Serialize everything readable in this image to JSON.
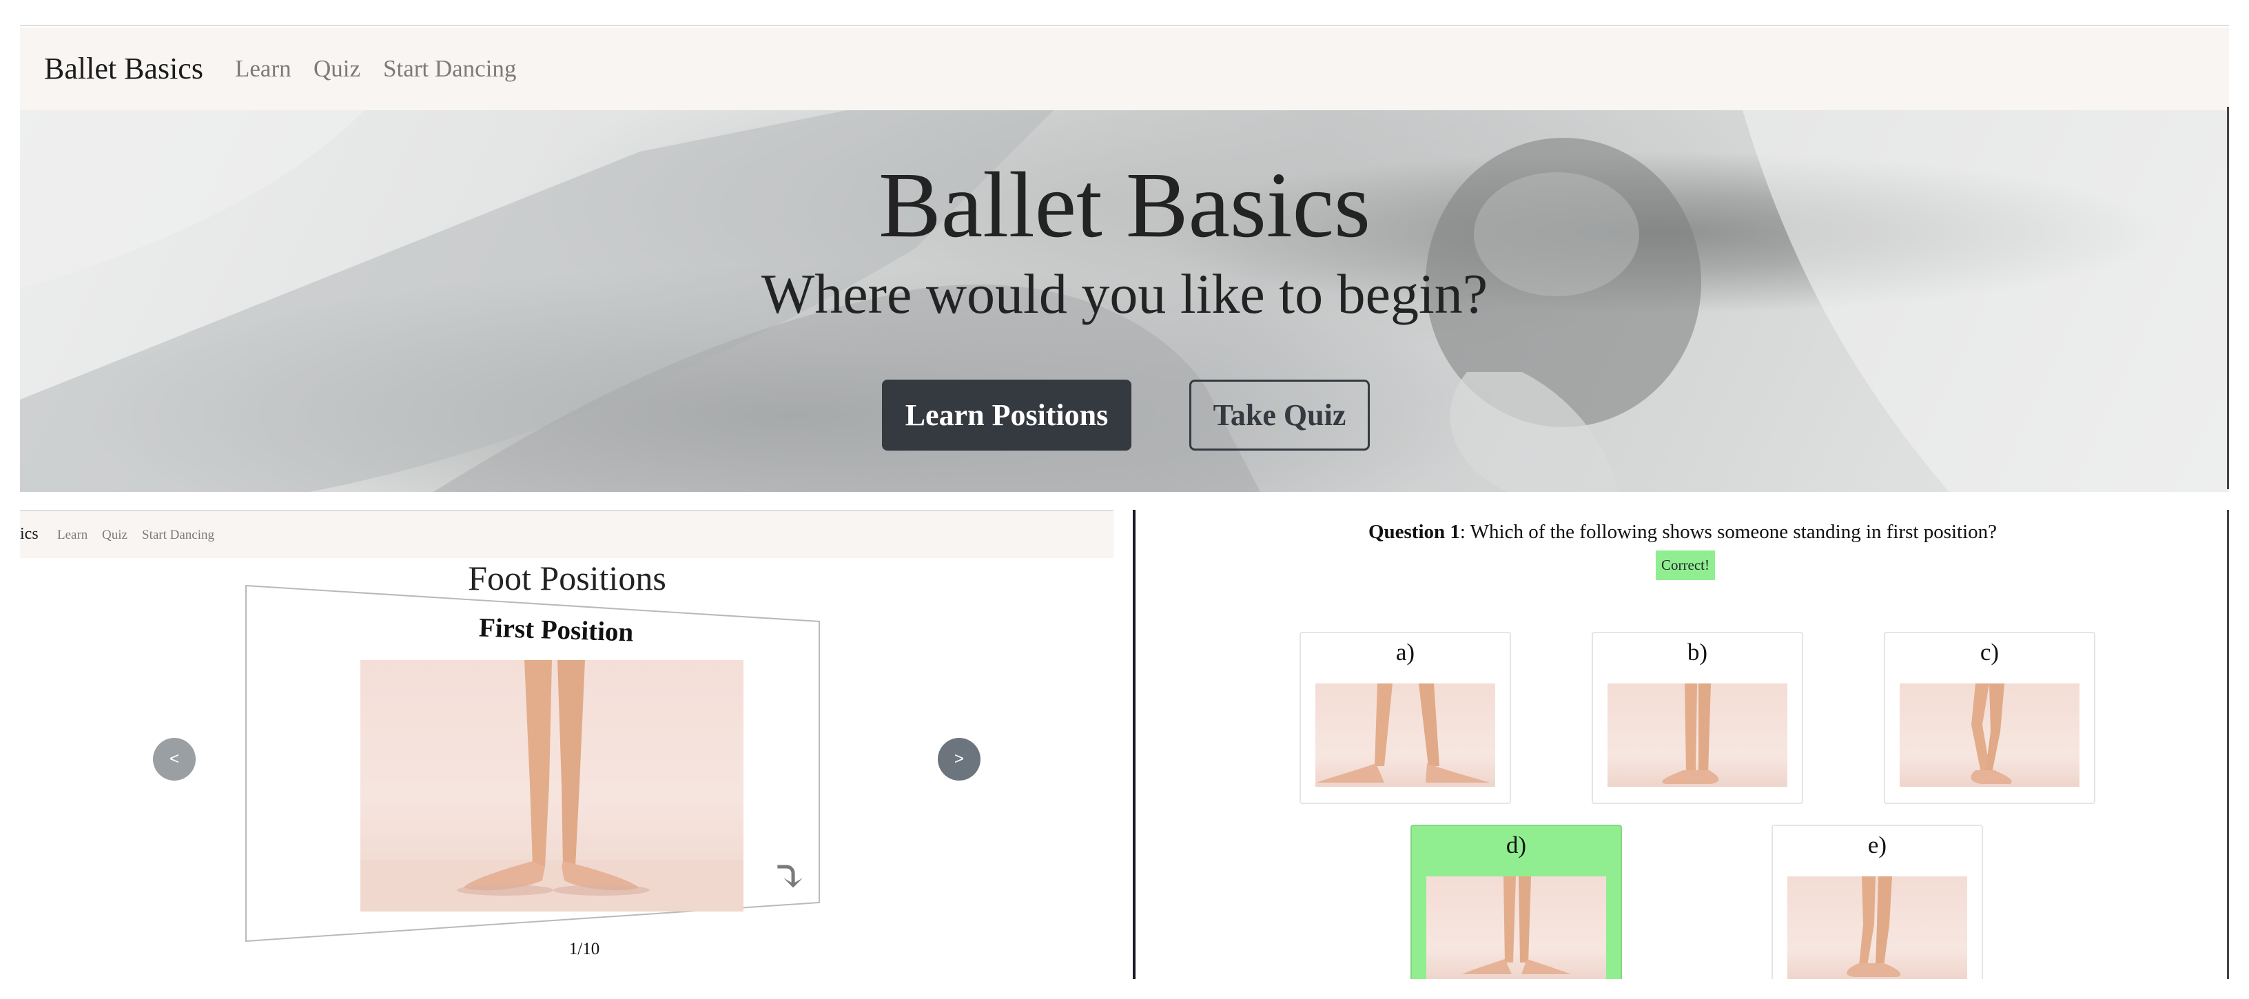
{
  "navbar": {
    "brand": "Ballet Basics",
    "links": [
      "Learn",
      "Quiz",
      "Start Dancing"
    ]
  },
  "hero": {
    "title": "Ballet Basics",
    "subtitle": "Where would you like to begin?",
    "primary_button": "Learn Positions",
    "secondary_button": "Take Quiz"
  },
  "learn": {
    "navbar": {
      "brand_fragment": "ics",
      "links": [
        "Learn",
        "Quiz",
        "Start Dancing"
      ]
    },
    "title": "Foot Positions",
    "card": {
      "heading": "First Position",
      "flip_icon": "curved-arrow-down-icon"
    },
    "prev_label": "<",
    "next_label": ">",
    "page_counter": "1/10"
  },
  "quiz": {
    "question_label": "Question 1",
    "question_text": ": Which of the following shows someone standing in first position?",
    "feedback": "Correct!",
    "options": [
      {
        "label": "a)",
        "selected": false
      },
      {
        "label": "b)",
        "selected": false
      },
      {
        "label": "c)",
        "selected": false
      },
      {
        "label": "d)",
        "selected": true
      },
      {
        "label": "e)",
        "selected": false
      }
    ]
  },
  "colors": {
    "navbar_bg": "#f8f5f2",
    "dark_button": "#343a40",
    "correct_green": "#90ee90",
    "muted_link": "#7b7b7b",
    "skin_tone": "#e8b48f"
  }
}
